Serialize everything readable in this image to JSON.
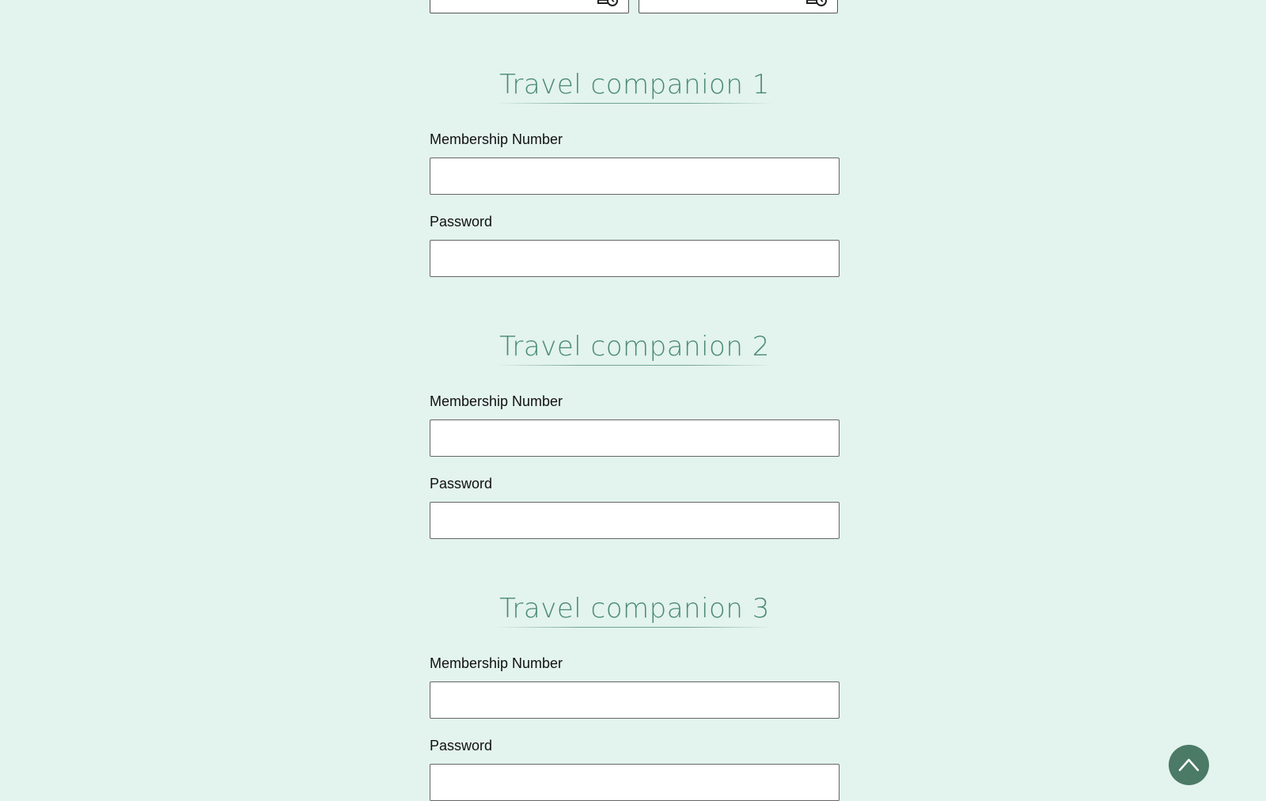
{
  "top_row": {
    "fields": [
      {
        "icon": "calendar-clock-icon"
      },
      {
        "icon": "calendar-clock-icon"
      }
    ]
  },
  "companions": [
    {
      "title": "Travel companion 1",
      "membership_label": "Membership Number",
      "membership_value": "",
      "password_label": "Password",
      "password_value": ""
    },
    {
      "title": "Travel companion 2",
      "membership_label": "Membership Number",
      "membership_value": "",
      "password_label": "Password",
      "password_value": ""
    },
    {
      "title": "Travel companion 3",
      "membership_label": "Membership Number",
      "membership_value": "",
      "password_label": "Password",
      "password_value": ""
    }
  ],
  "colors": {
    "background": "#e3f3ee",
    "accent": "#4a8a72",
    "fab": "#4b7a66"
  },
  "back_to_top": {
    "icon": "chevron-up-icon"
  }
}
